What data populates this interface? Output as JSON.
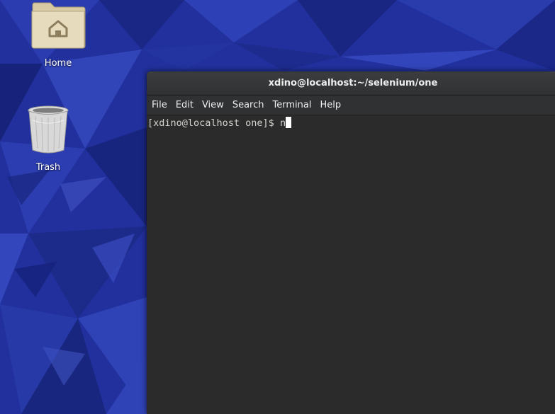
{
  "desktop": {
    "icons": [
      {
        "label": "Home",
        "icon": "home-folder-icon"
      },
      {
        "label": "Trash",
        "icon": "trash-icon"
      }
    ]
  },
  "terminal": {
    "title": "xdino@localhost:~/selenium/one",
    "menu": [
      "File",
      "Edit",
      "View",
      "Search",
      "Terminal",
      "Help"
    ],
    "prompt": "[xdino@localhost one]$ ",
    "input": "n"
  },
  "colors": {
    "wallpaper": "#1f2f9a",
    "terminal_background": "#2b2b2b",
    "titlebar": "#333537",
    "text": "#d3d7cf"
  }
}
